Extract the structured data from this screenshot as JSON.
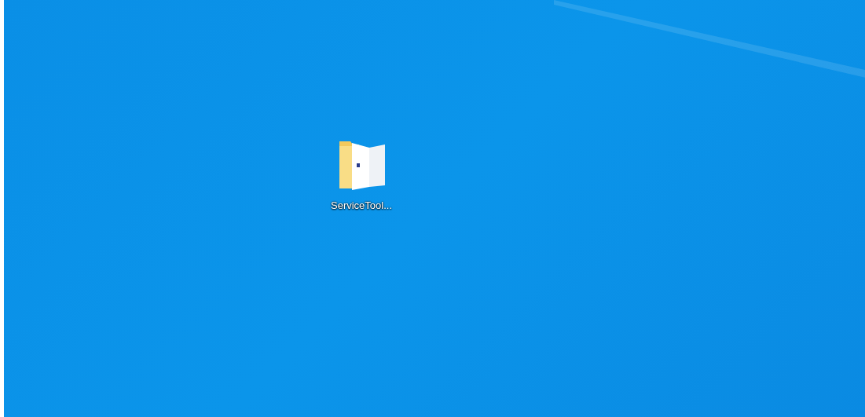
{
  "desktop": {
    "icons": [
      {
        "label": "ServiceTool...",
        "selected": false
      }
    ]
  }
}
